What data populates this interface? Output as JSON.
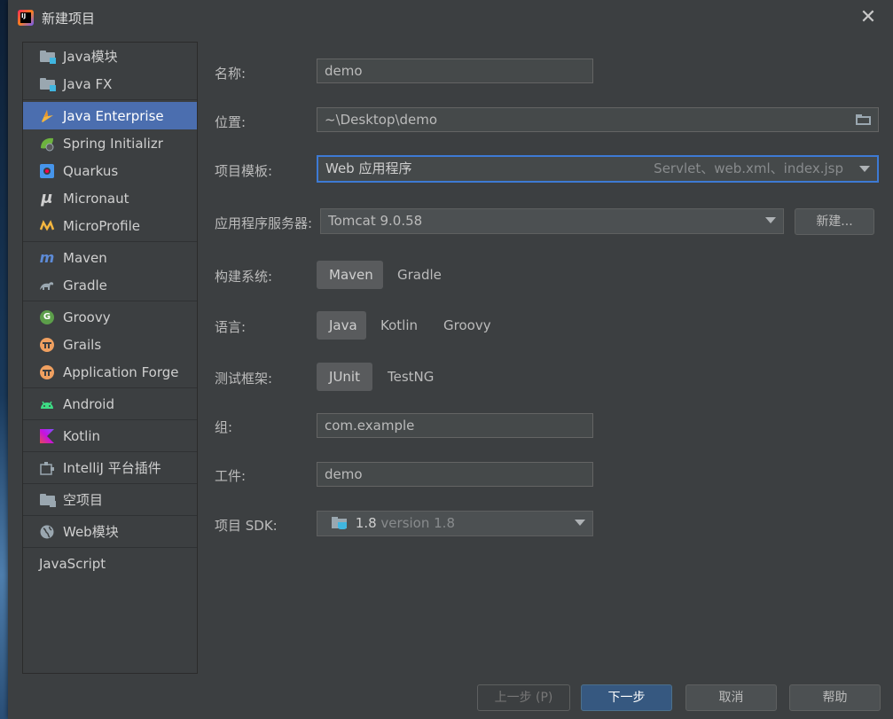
{
  "window": {
    "title": "新建项目",
    "close_icon": "close-icon"
  },
  "sidebar": {
    "items": [
      {
        "label": "Java模块",
        "icon": "module-folder-icon"
      },
      {
        "label": "Java FX",
        "icon": "module-folder-icon"
      },
      {
        "label": "Java Enterprise",
        "icon": "java-enterprise-icon",
        "selected": true
      },
      {
        "label": "Spring Initializr",
        "icon": "spring-icon"
      },
      {
        "label": "Quarkus",
        "icon": "quarkus-icon"
      },
      {
        "label": "Micronaut",
        "icon": "micronaut-icon"
      },
      {
        "label": "MicroProfile",
        "icon": "microprofile-icon"
      },
      {
        "label": "Maven",
        "icon": "maven-icon"
      },
      {
        "label": "Gradle",
        "icon": "gradle-icon"
      },
      {
        "label": "Groovy",
        "icon": "groovy-icon"
      },
      {
        "label": "Grails",
        "icon": "grails-icon"
      },
      {
        "label": "Application Forge",
        "icon": "application-forge-icon"
      },
      {
        "label": "Android",
        "icon": "android-icon"
      },
      {
        "label": "Kotlin",
        "icon": "kotlin-icon"
      },
      {
        "label": "IntelliJ 平台插件",
        "icon": "plugin-icon"
      },
      {
        "label": "空项目",
        "icon": "empty-folder-icon"
      },
      {
        "label": "Web模块",
        "icon": "globe-icon"
      },
      {
        "label": "JavaScript",
        "icon": ""
      }
    ]
  },
  "form": {
    "name": {
      "label": "名称:",
      "value": "demo"
    },
    "location": {
      "label": "位置:",
      "value": "~\\Desktop\\demo"
    },
    "template": {
      "label": "项目模板:",
      "value": "Web 应用程序",
      "hint": "Servlet、web.xml、index.jsp"
    },
    "server": {
      "label": "应用程序服务器:",
      "value": "Tomcat 9.0.58",
      "new_button": "新建..."
    },
    "build": {
      "label": "构建系统:",
      "options": [
        "Maven",
        "Gradle"
      ],
      "selected": "Maven"
    },
    "language": {
      "label": "语言:",
      "options": [
        "Java",
        "Kotlin",
        "Groovy"
      ],
      "selected": "Java"
    },
    "test": {
      "label": "测试框架:",
      "options": [
        "JUnit",
        "TestNG"
      ],
      "selected": "JUnit"
    },
    "group": {
      "label": "组:",
      "value": "com.example"
    },
    "artifact": {
      "label": "工件:",
      "value": "demo"
    },
    "sdk": {
      "label": "项目 SDK:",
      "value": "1.8",
      "version": "version 1.8"
    }
  },
  "footer": {
    "prev": "上一步 (P)",
    "next": "下一步",
    "cancel": "取消",
    "help": "帮助"
  },
  "colors": {
    "accent": "#4b6eaf",
    "background": "#3c3f41",
    "default_button": "#365880",
    "focus_border": "#3d7ad4"
  }
}
